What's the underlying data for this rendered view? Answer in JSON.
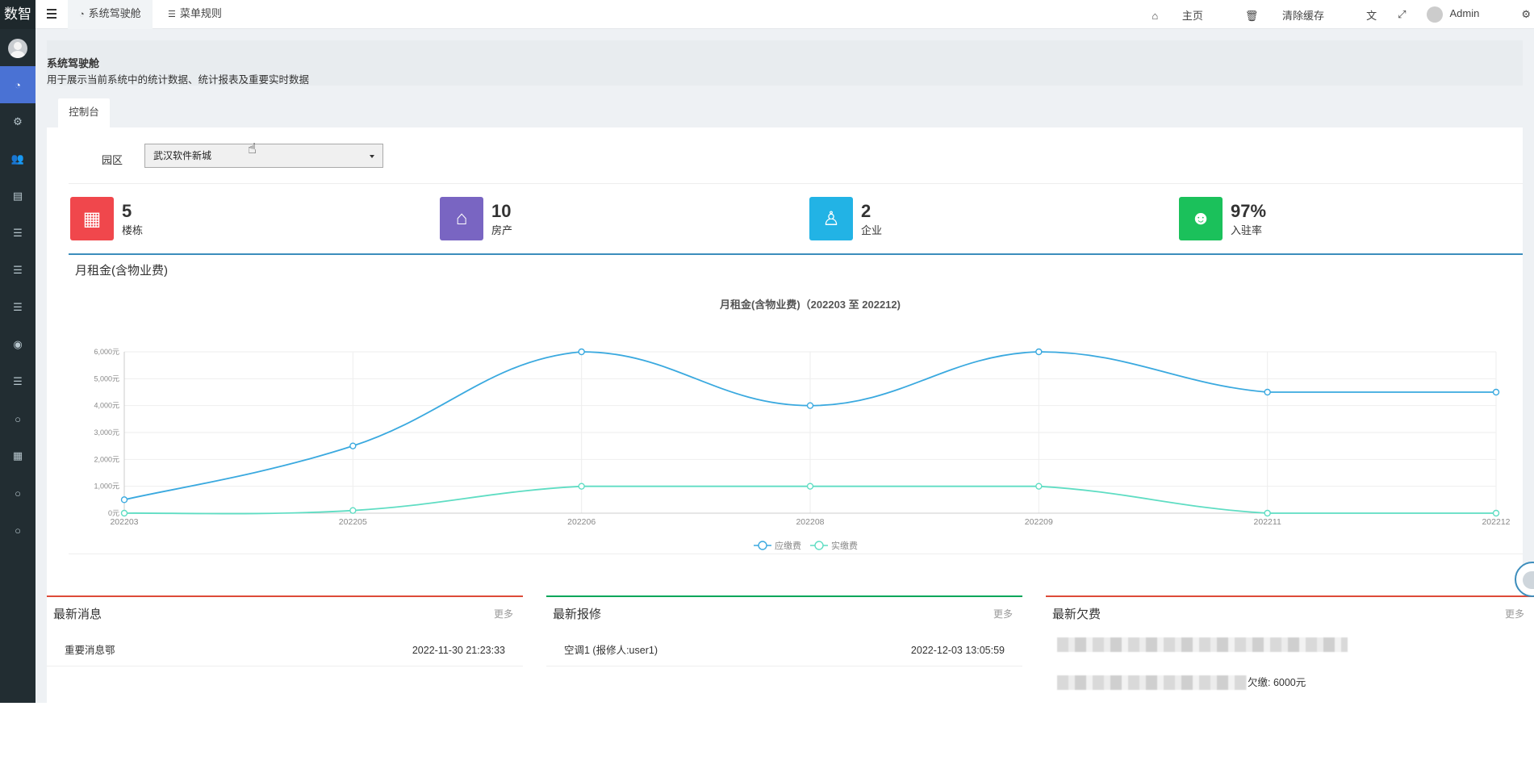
{
  "app": {
    "logo": "数智"
  },
  "sidebar": {
    "icons": [
      "avatar",
      "dashboard-icon",
      "cogs-icon",
      "users-icon",
      "table-icon",
      "list-icon",
      "list-icon",
      "list-icon",
      "user-circle-icon",
      "list-icon",
      "circle-icon",
      "building-icon",
      "circle-icon",
      "circle-icon"
    ]
  },
  "topbar": {
    "tabs": [
      {
        "label": "系统驾驶舱",
        "icon": "dashboard-icon"
      },
      {
        "label": "菜单规则",
        "icon": "list-icon"
      }
    ],
    "home": "主页",
    "clear_cache": "清除缓存",
    "user": "Admin"
  },
  "page": {
    "title": "系统驾驶舱",
    "description": "用于展示当前系统中的统计数据、统计报表及重要实时数据",
    "tab": "控制台"
  },
  "filter": {
    "label": "园区",
    "value": "武汉软件新城"
  },
  "stats": [
    {
      "value": "5",
      "label": "楼栋",
      "color": "#f0474c",
      "icon": "building-icon"
    },
    {
      "value": "10",
      "label": "房产",
      "color": "#7965c2",
      "icon": "home-icon"
    },
    {
      "value": "2",
      "label": "企业",
      "color": "#22b3e5",
      "icon": "person-icon"
    },
    {
      "value": "97%",
      "label": "入驻率",
      "color": "#1bc15b",
      "icon": "user-icon"
    }
  ],
  "chart_panel": {
    "heading": "月租金(含物业费)"
  },
  "chart_data": {
    "type": "line",
    "title": "月租金(含物业费)（202203 至 202212)",
    "categories": [
      "202203",
      "202205",
      "202206",
      "202208",
      "202209",
      "202211",
      "202212"
    ],
    "series": [
      {
        "name": "应缴费",
        "color": "#3aa9df",
        "values": [
          500,
          2500,
          6000,
          4000,
          6000,
          4500,
          4500
        ]
      },
      {
        "name": "实缴费",
        "color": "#5fddc3",
        "values": [
          0,
          100,
          1000,
          1000,
          1000,
          0,
          0
        ]
      }
    ],
    "y_ticks": [
      "0元",
      "1,000元",
      "2,000元",
      "3,000元",
      "4,000元",
      "5,000元",
      "6,000元"
    ],
    "ylim": [
      0,
      6000
    ],
    "smooth": true,
    "grid": true,
    "legend": "bottom"
  },
  "cards": {
    "messages": {
      "title": "最新消息",
      "more": "更多",
      "rows": [
        {
          "text": "重要消息鄂",
          "time": "2022-11-30 21:23:33"
        }
      ]
    },
    "repairs": {
      "title": "最新报修",
      "more": "更多",
      "rows": [
        {
          "text": "空调1 (报修人:user1)",
          "time": "2022-12-03 13:05:59"
        }
      ]
    },
    "arrears": {
      "title": "最新欠费",
      "more": "更多",
      "rows": [
        {
          "text": "欠缴: 6000元"
        }
      ]
    }
  }
}
